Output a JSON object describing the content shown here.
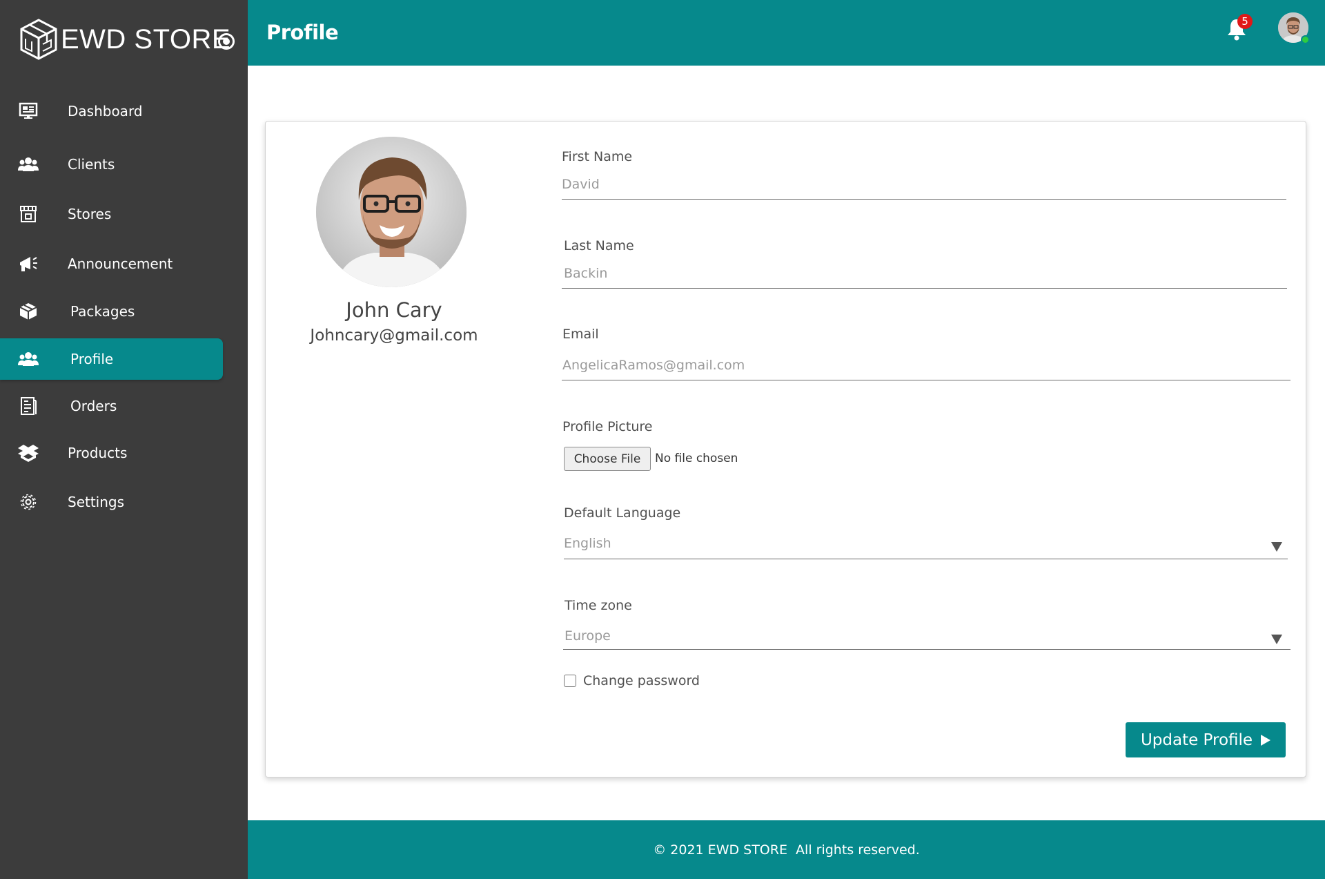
{
  "brand": {
    "name": "EWD STORE"
  },
  "sidebar": {
    "items": [
      {
        "label": "Dashboard",
        "icon": "dashboard-icon"
      },
      {
        "label": "Clients",
        "icon": "clients-icon"
      },
      {
        "label": "Stores",
        "icon": "stores-icon"
      },
      {
        "label": "Announcement",
        "icon": "megaphone-icon"
      },
      {
        "label": "Packages",
        "icon": "packages-icon"
      },
      {
        "label": "Profile",
        "icon": "users-icon",
        "active": true
      },
      {
        "label": "Orders",
        "icon": "orders-icon"
      },
      {
        "label": "Products",
        "icon": "products-icon"
      },
      {
        "label": "Settings",
        "icon": "gear-icon"
      }
    ]
  },
  "header": {
    "title": "Profile",
    "notification_count": "5"
  },
  "profile": {
    "name": "John Cary",
    "email": "Johncary@gmail.com"
  },
  "form": {
    "first_name": {
      "label": "First Name",
      "value": "David"
    },
    "last_name": {
      "label": "Last Name",
      "value": "Backin"
    },
    "email": {
      "label": "Email",
      "value": "AngelicaRamos@gmail.com"
    },
    "picture": {
      "label": "Profile Picture",
      "button": "Choose File",
      "status": "No file chosen"
    },
    "language": {
      "label": "Default Language",
      "value": "English"
    },
    "timezone": {
      "label": "Time zone",
      "value": "Europe"
    },
    "change_password": {
      "label": "Change password",
      "checked": false
    },
    "submit": "Update Profile"
  },
  "footer": {
    "text": "© 2021 EWD STORE  All rights reserved."
  },
  "colors": {
    "primary": "#06898c",
    "sidebar": "#3c3c3c",
    "badge": "#e01818",
    "online": "#2ecc40"
  }
}
